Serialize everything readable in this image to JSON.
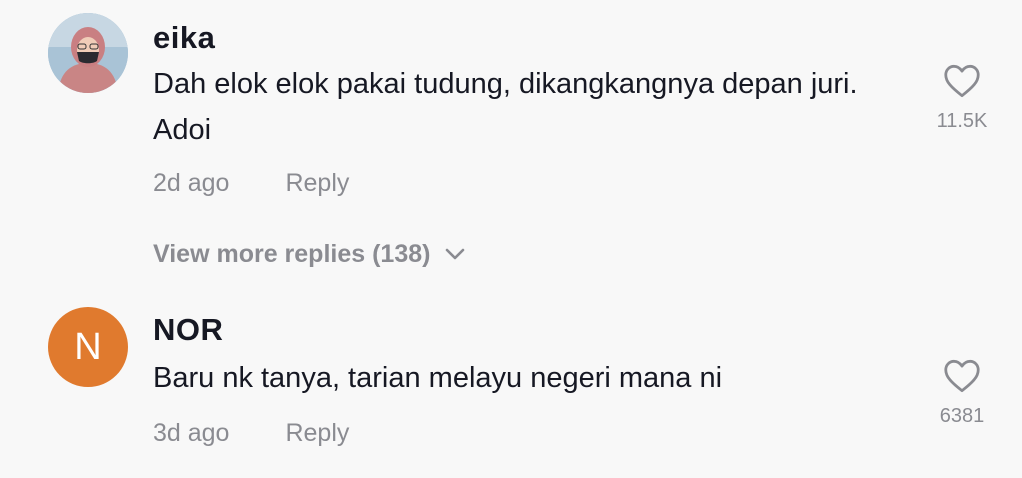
{
  "comments": [
    {
      "username": "eika",
      "text": "Dah elok elok pakai tudung, dikangkangnya depan juri. Adoi",
      "age": "2d ago",
      "reply_label": "Reply",
      "likes": "11.5K",
      "avatar": {
        "type": "photo",
        "icon": "user-photo"
      }
    },
    {
      "username": "NOR",
      "text": "Baru nk tanya, tarian melayu negeri mana ni",
      "age": "3d ago",
      "reply_label": "Reply",
      "likes": "6381",
      "avatar": {
        "type": "letter",
        "letter": "N",
        "color": "#e07a2e"
      }
    }
  ],
  "view_more_replies": "View more replies (138)",
  "colors": {
    "background": "#f8f8f8",
    "primary_text": "#161823",
    "secondary_text": "#8a8b91",
    "avatar_orange": "#e07a2e"
  },
  "icons": {
    "like": "heart-outline-icon",
    "expand": "chevron-down-icon"
  }
}
